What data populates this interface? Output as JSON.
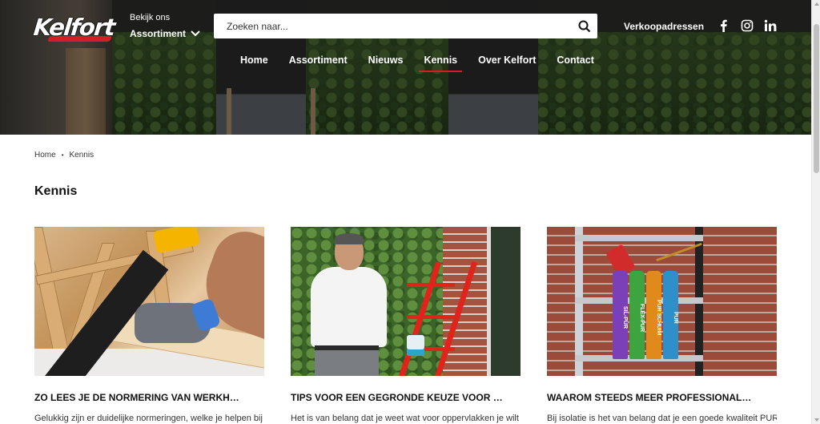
{
  "header": {
    "logo_text": "Kelfort",
    "assortment_small": "Bekijk ons",
    "assortment_label": "Assortiment",
    "search_placeholder": "Zoeken naar...",
    "verkoop_label": "Verkoopadressen",
    "social_icons": [
      "facebook-icon",
      "instagram-icon",
      "linkedin-icon"
    ]
  },
  "nav": [
    {
      "label": "Home",
      "active": false
    },
    {
      "label": "Assortiment",
      "active": false
    },
    {
      "label": "Nieuws",
      "active": false
    },
    {
      "label": "Kennis",
      "active": true
    },
    {
      "label": "Over Kelfort",
      "active": false
    },
    {
      "label": "Contact",
      "active": false
    }
  ],
  "breadcrumb": {
    "home": "Home",
    "separator": "•",
    "current": "Kennis"
  },
  "page_title": "Kennis",
  "cards": [
    {
      "title": "ZO LEES JE DE NORMERING VAN WERKH…",
      "excerpt": "Gelukkig zijn er duidelijke normeringen, welke je helpen bij"
    },
    {
      "title": "TIPS VOOR EEN GEGRONDE KEUZE VOOR …",
      "excerpt": "Het is van belang dat je weet wat voor oppervlakken je wilt"
    },
    {
      "title": "WAAROM STEEDS MEER PROFESSIONAL…",
      "excerpt": "Bij isolatie is het van belang dat je een goede kwaliteit PUR"
    }
  ],
  "product_cans": [
    "SIL-PUR",
    "FLEX-PUR",
    "PUR SCHUIM",
    "PUR"
  ],
  "colors": {
    "accent": "#d11e27",
    "text": "#111111",
    "white": "#ffffff"
  }
}
